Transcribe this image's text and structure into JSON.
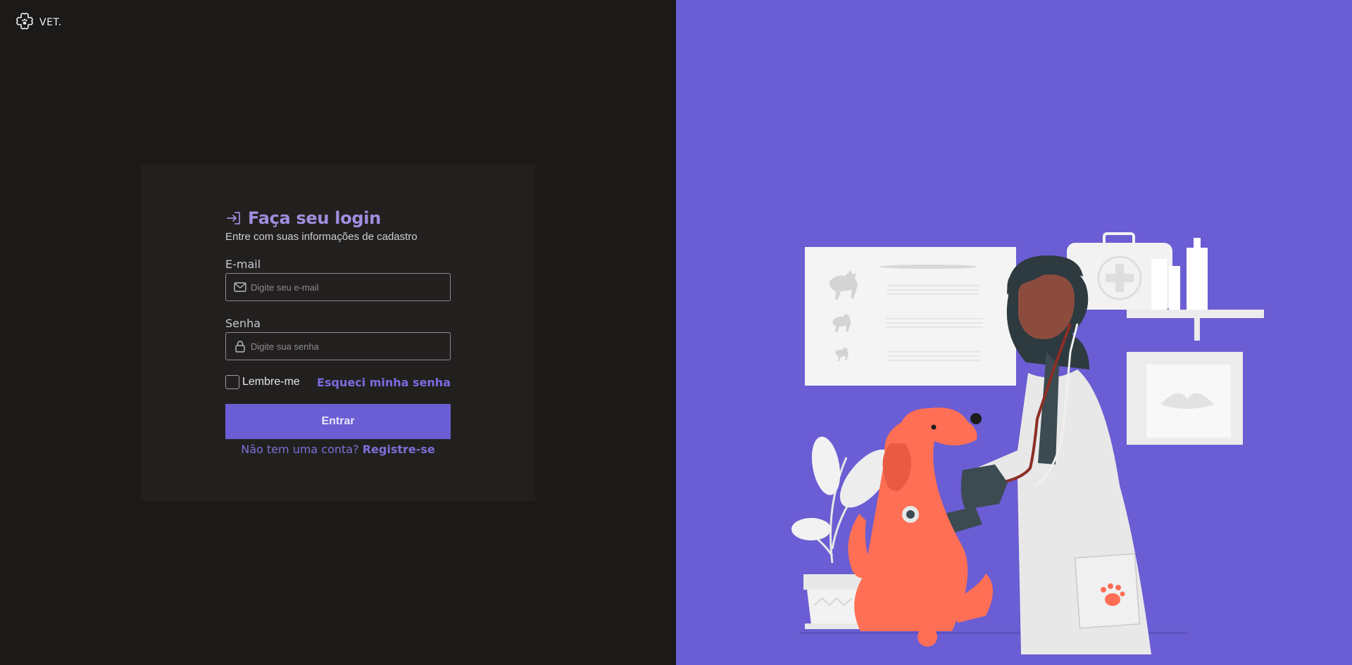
{
  "brand": {
    "logo_icon": "paw-cross-icon",
    "name": "VET."
  },
  "login": {
    "header_icon": "login-arrow-icon",
    "title": "Faça seu login",
    "subtitle": "Entre com suas informações de cadastro",
    "email": {
      "label": "E-mail",
      "icon": "envelope-icon",
      "placeholder": "Digite seu e-mail",
      "value": ""
    },
    "password": {
      "label": "Senha",
      "icon": "lock-icon",
      "placeholder": "Digite sua senha",
      "value": ""
    },
    "remember_me": {
      "label": "Lembre-me",
      "checked": false
    },
    "forgot_password": "Esqueci minha senha",
    "submit_label": "Entrar",
    "register_prompt": "Não tem uma conta?",
    "register_link": "Registre-se"
  },
  "illustration": {
    "subject": "veterinarian-examining-dog-illustration"
  },
  "colors": {
    "left_background": "#1b1a19",
    "card_background": "#22201e",
    "accent": "#6b5dd3",
    "title": "#9f8fe0",
    "link": "#7c6ae0",
    "illustration_background": "#6b5dd3",
    "dog": "#fe6f55"
  }
}
